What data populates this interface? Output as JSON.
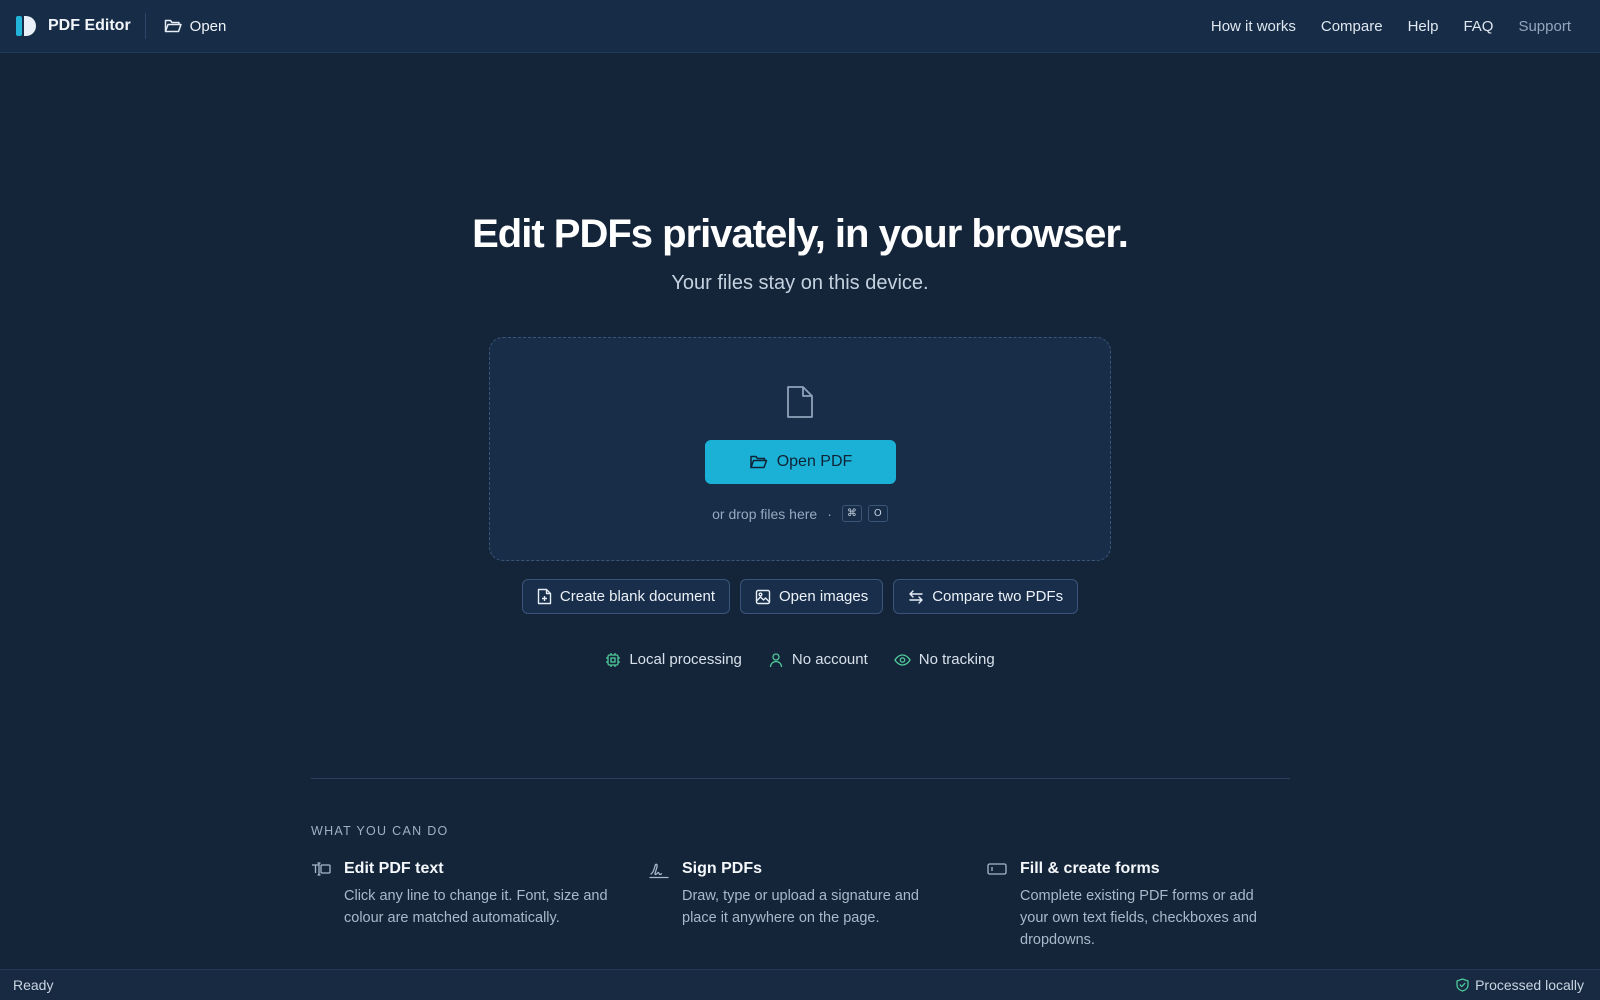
{
  "app": {
    "name": "PDF Editor",
    "open_label": "Open"
  },
  "nav": [
    {
      "label": "How it works"
    },
    {
      "label": "Compare"
    },
    {
      "label": "Help"
    },
    {
      "label": "FAQ"
    },
    {
      "label": "Support"
    }
  ],
  "hero": {
    "title": "Edit PDFs privately, in your browser.",
    "subtitle": "Your files stay on this device."
  },
  "dropzone": {
    "icon": "file-icon",
    "button_label": "Open PDF",
    "hint": "or drop files here",
    "separator": "·",
    "shortcut_keys": [
      "⌘",
      "O"
    ]
  },
  "actions": [
    {
      "label": "Create blank document",
      "icon": "file-plus-icon"
    },
    {
      "label": "Open images",
      "icon": "image-icon"
    },
    {
      "label": "Compare two PDFs",
      "icon": "compare-arrows-icon"
    }
  ],
  "trust": [
    {
      "label": "Local processing",
      "icon": "cpu-icon"
    },
    {
      "label": "No account",
      "icon": "user-icon"
    },
    {
      "label": "No tracking",
      "icon": "eye-icon"
    }
  ],
  "features_section": {
    "label": "WHAT YOU CAN DO",
    "items": [
      {
        "title": "Edit PDF text",
        "desc": "Click any line to change it. Font, size and colour are matched automatically.",
        "icon": "text-cursor-icon"
      },
      {
        "title": "Sign PDFs",
        "desc": "Draw, type or upload a signature and place it anywhere on the page.",
        "icon": "signature-icon"
      },
      {
        "title": "Fill & create forms",
        "desc": "Complete existing PDF forms or add your own text fields, checkboxes and dropdowns.",
        "icon": "form-field-icon"
      }
    ]
  },
  "status": {
    "left": "Ready",
    "right": "Processed locally",
    "right_icon": "shield-check-icon"
  },
  "colors": {
    "background": "#14253a",
    "accent": "#1bb1d6",
    "trust_icon": "#4fc99a"
  }
}
